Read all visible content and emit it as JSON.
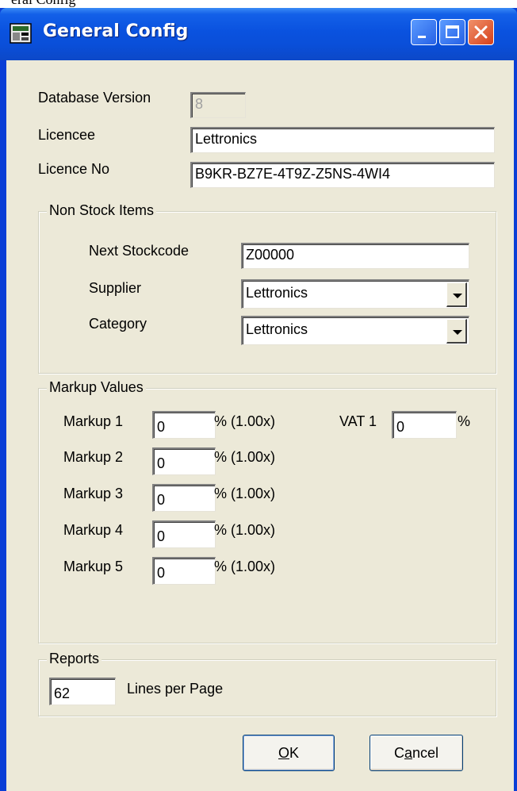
{
  "window": {
    "title": "General Config",
    "partial_top_text": "eral Config"
  },
  "general": {
    "database_version_label": "Database Version",
    "database_version_value": "8",
    "licencee_label": "Licencee",
    "licencee_value": "Lettronics",
    "licence_no_label": "Licence No",
    "licence_no_value": "B9KR-BZ7E-4T9Z-Z5NS-4WI4"
  },
  "non_stock": {
    "group_title": "Non Stock Items",
    "next_stockcode_label": "Next Stockcode",
    "next_stockcode_value": "Z00000",
    "supplier_label": "Supplier",
    "supplier_value": "Lettronics",
    "category_label": "Category",
    "category_value": "Lettronics"
  },
  "markup": {
    "group_title": "Markup Values",
    "rows": [
      {
        "label": "Markup 1",
        "value": "0",
        "suffix": "% (1.00x)"
      },
      {
        "label": "Markup 2",
        "value": "0",
        "suffix": "% (1.00x)"
      },
      {
        "label": "Markup 3",
        "value": "0",
        "suffix": "% (1.00x)"
      },
      {
        "label": "Markup 4",
        "value": "0",
        "suffix": "% (1.00x)"
      },
      {
        "label": "Markup 5",
        "value": "0",
        "suffix": "% (1.00x)"
      }
    ],
    "vat_label": "VAT 1",
    "vat_value": "0",
    "vat_suffix": "%"
  },
  "reports": {
    "group_title": "Reports",
    "lines_value": "62",
    "lines_label": "Lines per Page"
  },
  "buttons": {
    "ok_mnemonic": "O",
    "ok_rest": "K",
    "cancel_pre": "C",
    "cancel_mnemonic": "a",
    "cancel_post": "ncel"
  }
}
